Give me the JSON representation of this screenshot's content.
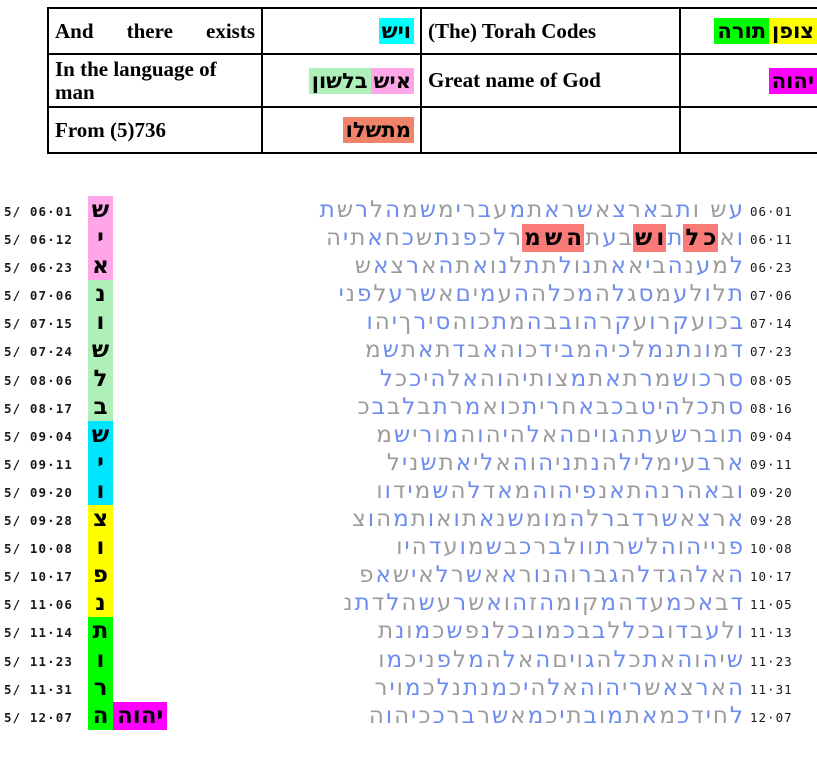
{
  "legend": {
    "rows": [
      {
        "english_left": "And there exists",
        "hebrew_left": [
          {
            "t": "ויש",
            "bg": "c-cyan"
          }
        ],
        "english_right": "(The) Torah Codes",
        "hebrew_right": [
          {
            "t": "תורה",
            "bg": "c-green"
          },
          {
            "t": "צופן",
            "bg": "c-yellow"
          }
        ]
      },
      {
        "english_left": "In the language of man",
        "hebrew_left": [
          {
            "t": "איש",
            "bg": "c-pink"
          },
          {
            "t": "בלשון",
            "bg": "c-lgreen"
          }
        ],
        "english_right": "Great name of God",
        "hebrew_right": [
          {
            "t": "יהוה",
            "bg": "c-magenta"
          }
        ]
      },
      {
        "english_left": "From (5)736",
        "hebrew_left": [
          {
            "t": "מתשלו",
            "bg": "c-salmon"
          }
        ],
        "english_right": "",
        "hebrew_right": []
      }
    ]
  },
  "matrix": {
    "rows": [
      {
        "ref_left": "5/ 06·01",
        "ref_right": "06·01",
        "els": {
          "letter": "ש",
          "bg": "hl-pink"
        },
        "letters": "עש ותבארצאשראתמעברימשמהלרשת"
      },
      {
        "ref_left": "5/ 06·12",
        "ref_right": "06·11",
        "els": {
          "letter": "י",
          "bg": "hl-pink"
        },
        "letters": "ואכלתושבעתהשמרלכפנתשכחאתיה"
      },
      {
        "ref_left": "5/ 06·23",
        "ref_right": "06·23",
        "els": {
          "letter": "א",
          "bg": "hl-pink"
        },
        "letters": "למענהביאאתנולתתלנואתהארצאש"
      },
      {
        "ref_left": "5/ 07·06",
        "ref_right": "07·06",
        "els": {
          "letter": "נ",
          "bg": "hl-lgreen"
        },
        "letters": "תלולעמסגלהמכלההעמיםאשרעלפני"
      },
      {
        "ref_left": "5/ 07·15",
        "ref_right": "07·14",
        "els": {
          "letter": "ו",
          "bg": "hl-lgreen"
        },
        "letters": "בכועקרועקרהובבהמתכוהסירךיהו"
      },
      {
        "ref_left": "5/ 07·24",
        "ref_right": "07·23",
        "els": {
          "letter": "ש",
          "bg": "hl-lgreen"
        },
        "letters": "דמונתנמלכיהמבידכוהאבדתאתשמ"
      },
      {
        "ref_left": "5/ 08·06",
        "ref_right": "08·05",
        "els": {
          "letter": "ל",
          "bg": "hl-lgreen"
        },
        "letters": "סרכושמרתאתמצותיהוהאלהיככל"
      },
      {
        "ref_left": "5/ 08·17",
        "ref_right": "08·16",
        "els": {
          "letter": "ב",
          "bg": "hl-lgreen"
        },
        "letters": "סתכלהיטבכבאחריתכואמרתבלבבכ"
      },
      {
        "ref_left": "5/ 09·04",
        "ref_right": "09·04",
        "els": {
          "letter": "ש",
          "bg": "hl-cyan"
        },
        "letters": "תוברשעתהגויםהאלהיהוהמורישמ"
      },
      {
        "ref_left": "5/ 09·11",
        "ref_right": "09·11",
        "els": {
          "letter": "י",
          "bg": "hl-cyan"
        },
        "letters": "ארבעימלילהנתניהוהאליאתשניל"
      },
      {
        "ref_left": "5/ 09·20",
        "ref_right": "09·20",
        "els": {
          "letter": "ו",
          "bg": "hl-cyan"
        },
        "letters": "ובאהרנהתאנפיהוהמאדלהשמידוו"
      },
      {
        "ref_left": "5/ 09·28",
        "ref_right": "09·28",
        "els": {
          "letter": "צ",
          "bg": "hl-yellow"
        },
        "letters": "ארצאשרדברלהמומשנאתואותמהוצ"
      },
      {
        "ref_left": "5/ 10·08",
        "ref_right": "10·08",
        "els": {
          "letter": "ו",
          "bg": "hl-yellow"
        },
        "letters": "פנייהוהלשרתוולברכבשמועדהיו"
      },
      {
        "ref_left": "5/ 10·17",
        "ref_right": "10·17",
        "els": {
          "letter": "פ",
          "bg": "hl-yellow"
        },
        "letters": "האלהגדלהגברוהנוראאשרלאישאפ"
      },
      {
        "ref_left": "5/ 11·06",
        "ref_right": "11·05",
        "els": {
          "letter": "נ",
          "bg": "hl-yellow"
        },
        "letters": "דבאכמעדהמקומהזהואשרעשהלדתנ"
      },
      {
        "ref_left": "5/ 11·14",
        "ref_right": "11·13",
        "els": {
          "letter": "ת",
          "bg": "hl-green"
        },
        "letters": "ולעבדובכללבבכמובכלנפשכמונת"
      },
      {
        "ref_left": "5/ 11·23",
        "ref_right": "11·23",
        "els": {
          "letter": "ו",
          "bg": "hl-green"
        },
        "letters": "שיהוהאתכלהגויםהאלהמלפניכמו"
      },
      {
        "ref_left": "5/ 11·31",
        "ref_right": "11·31",
        "els": {
          "letter": "ר",
          "bg": "hl-green"
        },
        "letters": "הארצאשריהוהאלהיכמנתנלכמויר"
      },
      {
        "ref_left": "5/ 12·07",
        "ref_right": "12·07",
        "els": {
          "letter": "ה",
          "bg": "hl-green"
        },
        "letters": "לחידכמאתמובתיכמאשרברככיהוה"
      }
    ],
    "red_marks_row": 2,
    "magenta_word_last_row": "יהוה"
  },
  "colors": {
    "letter_blue": "#6C8CF0",
    "letter_gray": "#9C9C9C",
    "cyan": "#00FFFF",
    "green": "#00FF00",
    "yellow": "#FFFF00",
    "pink": "#FFA6E8",
    "light_green": "#AFF0B8",
    "magenta": "#FF00FF",
    "salmon": "#F0846A",
    "red": "#FA7A78"
  }
}
